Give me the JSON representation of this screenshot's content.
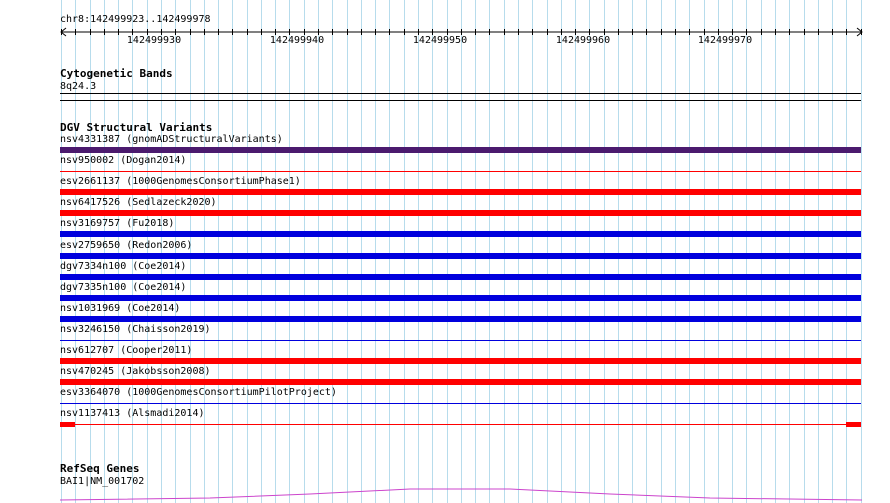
{
  "ruler": {
    "location": "chr8:142499923..142499978",
    "ticks": [
      "142499930",
      "142499940",
      "142499950",
      "142499960",
      "142499970"
    ]
  },
  "cytoband_track": {
    "title": "Cytogenetic Bands",
    "band": "8q24.3"
  },
  "dgv_track": {
    "title": "DGV Structural Variants",
    "variants": [
      {
        "label": "nsv4331387 (gnomADStructuralVariants)",
        "color": "#4b1a6e",
        "style": "thick"
      },
      {
        "label": "nsv950002 (Dogan2014)",
        "color": "#ff0000",
        "style": "thin"
      },
      {
        "label": "esv2661137 (1000GenomesConsortiumPhase1)",
        "color": "#ff0000",
        "style": "thick"
      },
      {
        "label": "nsv6417526 (Sedlazeck2020)",
        "color": "#ff0000",
        "style": "thick"
      },
      {
        "label": "nsv3169757 (Fu2018)",
        "color": "#0000dd",
        "style": "thick"
      },
      {
        "label": "esv2759650 (Redon2006)",
        "color": "#0000dd",
        "style": "thick"
      },
      {
        "label": "dgv7334n100 (Coe2014)",
        "color": "#0000dd",
        "style": "thick"
      },
      {
        "label": "dgv7335n100 (Coe2014)",
        "color": "#0000dd",
        "style": "thick"
      },
      {
        "label": "nsv1031969 (Coe2014)",
        "color": "#0000dd",
        "style": "thick"
      },
      {
        "label": "nsv3246150 (Chaisson2019)",
        "color": "#0000dd",
        "style": "thin"
      },
      {
        "label": "nsv612707 (Cooper2011)",
        "color": "#ff0000",
        "style": "thick"
      },
      {
        "label": "nsv470245 (Jakobsson2008)",
        "color": "#ff0000",
        "style": "thick"
      },
      {
        "label": "esv3364070 (1000GenomesConsortiumPilotProject)",
        "color": "#0000dd",
        "style": "thin"
      },
      {
        "label": "nsv1137413 (Alsmadi2014)",
        "color": "#ff0000",
        "style": "ends"
      }
    ]
  },
  "refseq_track": {
    "title": "RefSeq Genes",
    "gene": "BAI1|NM_001702",
    "color": "#cc44cc"
  }
}
